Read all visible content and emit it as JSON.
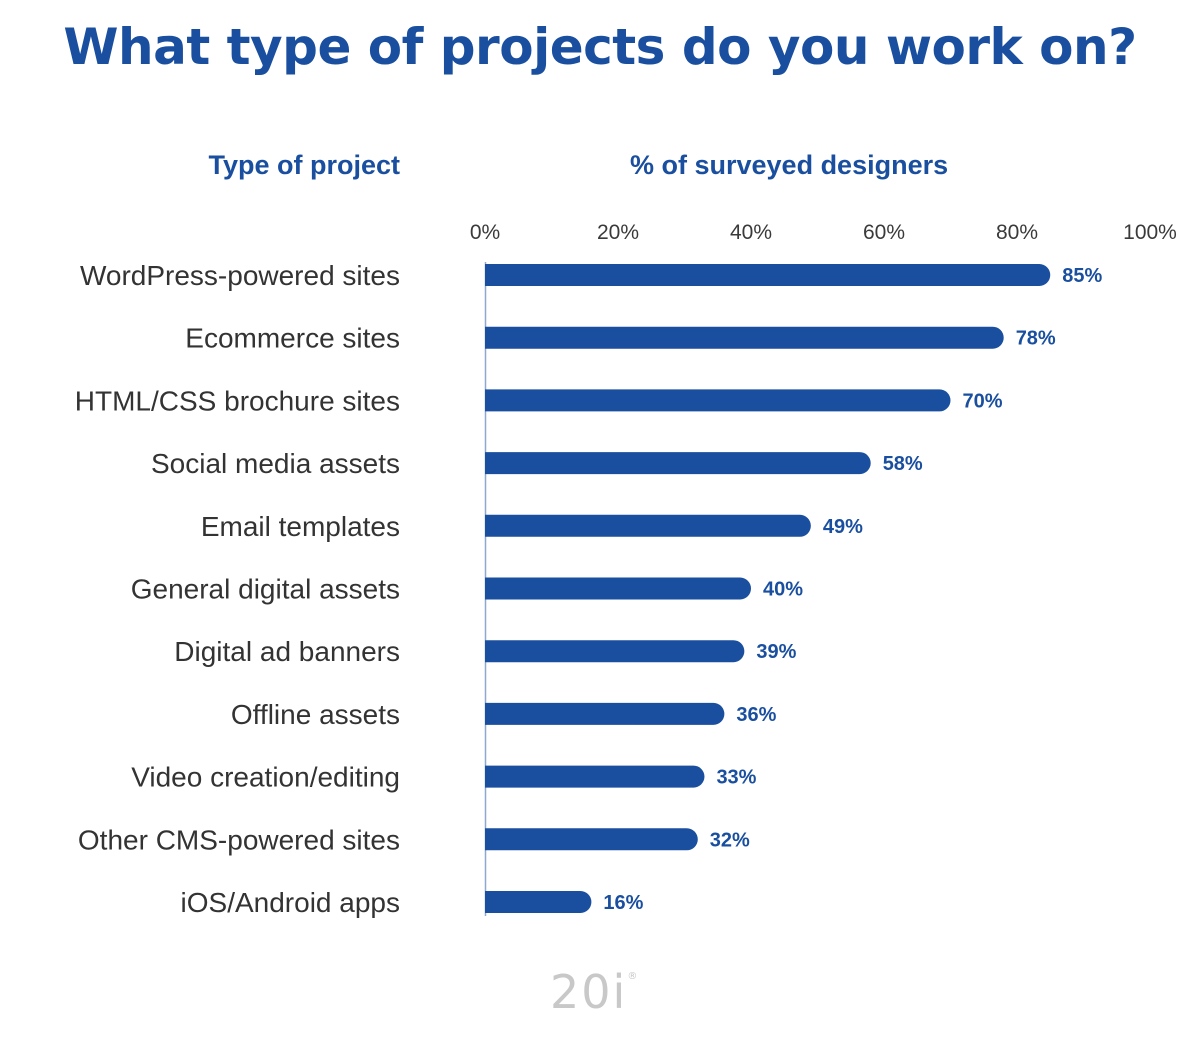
{
  "chart_data": {
    "type": "bar",
    "orientation": "horizontal",
    "title": "What type of projects do you work on?",
    "ylabel": "Type of project",
    "xlabel": "% of surveyed designers",
    "xlim": [
      0,
      100
    ],
    "xticks": [
      "0%",
      "20%",
      "40%",
      "60%",
      "80%",
      "100%"
    ],
    "xtick_values": [
      0,
      20,
      40,
      60,
      80,
      100
    ],
    "grid": false,
    "legend": "none",
    "bar_color": "#1a4f9f",
    "categories": [
      "WordPress-powered sites",
      "Ecommerce sites",
      "HTML/CSS brochure sites",
      "Social media assets",
      "Email templates",
      "General digital assets",
      "Digital ad banners",
      "Offline assets",
      "Video creation/editing",
      "Other CMS-powered sites",
      "iOS/Android apps"
    ],
    "values": [
      85,
      78,
      70,
      58,
      49,
      40,
      39,
      36,
      33,
      32,
      16
    ],
    "value_labels": [
      "85%",
      "78%",
      "70%",
      "58%",
      "49%",
      "40%",
      "39%",
      "36%",
      "33%",
      "32%",
      "16%"
    ]
  },
  "branding": {
    "logo_text": "20i",
    "logo_mark": "®"
  }
}
